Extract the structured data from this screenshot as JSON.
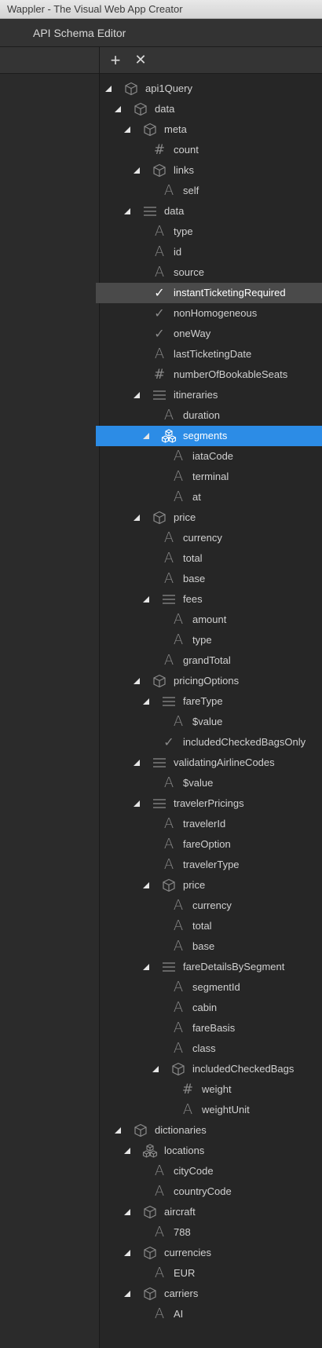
{
  "window": {
    "title": "Wappler - The Visual Web App Creator"
  },
  "panel": {
    "title": "API Schema Editor"
  },
  "toolbar": {
    "add_symbol": "+",
    "remove_symbol": "✕"
  },
  "tree": [
    {
      "label": "api1Query",
      "icon": "object",
      "level": 0,
      "expand": true
    },
    {
      "label": "data",
      "icon": "object",
      "level": 1,
      "expand": true
    },
    {
      "label": "meta",
      "icon": "object",
      "level": 2,
      "expand": true
    },
    {
      "label": "count",
      "icon": "number",
      "level": 3,
      "expand": false
    },
    {
      "label": "links",
      "icon": "object",
      "level": 3,
      "expand": true
    },
    {
      "label": "self",
      "icon": "text",
      "level": 4,
      "expand": false
    },
    {
      "label": "data",
      "icon": "array",
      "level": 2,
      "expand": true
    },
    {
      "label": "type",
      "icon": "text",
      "level": 3,
      "expand": false
    },
    {
      "label": "id",
      "icon": "text",
      "level": 3,
      "expand": false
    },
    {
      "label": "source",
      "icon": "text",
      "level": 3,
      "expand": false
    },
    {
      "label": "instantTicketingRequired",
      "icon": "boolean",
      "level": 3,
      "expand": false,
      "state": "selected"
    },
    {
      "label": "nonHomogeneous",
      "icon": "boolean",
      "level": 3,
      "expand": false
    },
    {
      "label": "oneWay",
      "icon": "boolean",
      "level": 3,
      "expand": false
    },
    {
      "label": "lastTicketingDate",
      "icon": "text",
      "level": 3,
      "expand": false
    },
    {
      "label": "numberOfBookableSeats",
      "icon": "number",
      "level": 3,
      "expand": false
    },
    {
      "label": "itineraries",
      "icon": "array",
      "level": 3,
      "expand": true
    },
    {
      "label": "duration",
      "icon": "text",
      "level": 4,
      "expand": false
    },
    {
      "label": "segments",
      "icon": "collection",
      "level": 4,
      "expand": true,
      "state": "active"
    },
    {
      "label": "iataCode",
      "icon": "text",
      "level": 5,
      "expand": false
    },
    {
      "label": "terminal",
      "icon": "text",
      "level": 5,
      "expand": false
    },
    {
      "label": "at",
      "icon": "text",
      "level": 5,
      "expand": false
    },
    {
      "label": "price",
      "icon": "object",
      "level": 3,
      "expand": true
    },
    {
      "label": "currency",
      "icon": "text",
      "level": 4,
      "expand": false
    },
    {
      "label": "total",
      "icon": "text",
      "level": 4,
      "expand": false
    },
    {
      "label": "base",
      "icon": "text",
      "level": 4,
      "expand": false
    },
    {
      "label": "fees",
      "icon": "array",
      "level": 4,
      "expand": true
    },
    {
      "label": "amount",
      "icon": "text",
      "level": 5,
      "expand": false
    },
    {
      "label": "type",
      "icon": "text",
      "level": 5,
      "expand": false
    },
    {
      "label": "grandTotal",
      "icon": "text",
      "level": 4,
      "expand": false
    },
    {
      "label": "pricingOptions",
      "icon": "object",
      "level": 3,
      "expand": true
    },
    {
      "label": "fareType",
      "icon": "array",
      "level": 4,
      "expand": true
    },
    {
      "label": "$value",
      "icon": "text",
      "level": 5,
      "expand": false
    },
    {
      "label": "includedCheckedBagsOnly",
      "icon": "boolean",
      "level": 4,
      "expand": false
    },
    {
      "label": "validatingAirlineCodes",
      "icon": "array",
      "level": 3,
      "expand": true
    },
    {
      "label": "$value",
      "icon": "text",
      "level": 4,
      "expand": false
    },
    {
      "label": "travelerPricings",
      "icon": "array",
      "level": 3,
      "expand": true
    },
    {
      "label": "travelerId",
      "icon": "text",
      "level": 4,
      "expand": false
    },
    {
      "label": "fareOption",
      "icon": "text",
      "level": 4,
      "expand": false
    },
    {
      "label": "travelerType",
      "icon": "text",
      "level": 4,
      "expand": false
    },
    {
      "label": "price",
      "icon": "object",
      "level": 4,
      "expand": true
    },
    {
      "label": "currency",
      "icon": "text",
      "level": 5,
      "expand": false
    },
    {
      "label": "total",
      "icon": "text",
      "level": 5,
      "expand": false
    },
    {
      "label": "base",
      "icon": "text",
      "level": 5,
      "expand": false
    },
    {
      "label": "fareDetailsBySegment",
      "icon": "array",
      "level": 4,
      "expand": true
    },
    {
      "label": "segmentId",
      "icon": "text",
      "level": 5,
      "expand": false
    },
    {
      "label": "cabin",
      "icon": "text",
      "level": 5,
      "expand": false
    },
    {
      "label": "fareBasis",
      "icon": "text",
      "level": 5,
      "expand": false
    },
    {
      "label": "class",
      "icon": "text",
      "level": 5,
      "expand": false
    },
    {
      "label": "includedCheckedBags",
      "icon": "object",
      "level": 5,
      "expand": true
    },
    {
      "label": "weight",
      "icon": "number",
      "level": 6,
      "expand": false
    },
    {
      "label": "weightUnit",
      "icon": "text",
      "level": 6,
      "expand": false
    },
    {
      "label": "dictionaries",
      "icon": "object",
      "level": 1,
      "expand": true
    },
    {
      "label": "locations",
      "icon": "collection",
      "level": 2,
      "expand": true
    },
    {
      "label": "cityCode",
      "icon": "text",
      "level": 3,
      "expand": false
    },
    {
      "label": "countryCode",
      "icon": "text",
      "level": 3,
      "expand": false
    },
    {
      "label": "aircraft",
      "icon": "object",
      "level": 2,
      "expand": true
    },
    {
      "label": "788",
      "icon": "text",
      "level": 3,
      "expand": false
    },
    {
      "label": "currencies",
      "icon": "object",
      "level": 2,
      "expand": true
    },
    {
      "label": "EUR",
      "icon": "text",
      "level": 3,
      "expand": false
    },
    {
      "label": "carriers",
      "icon": "object",
      "level": 2,
      "expand": true
    },
    {
      "label": "AI",
      "icon": "text",
      "level": 3,
      "expand": false
    }
  ]
}
